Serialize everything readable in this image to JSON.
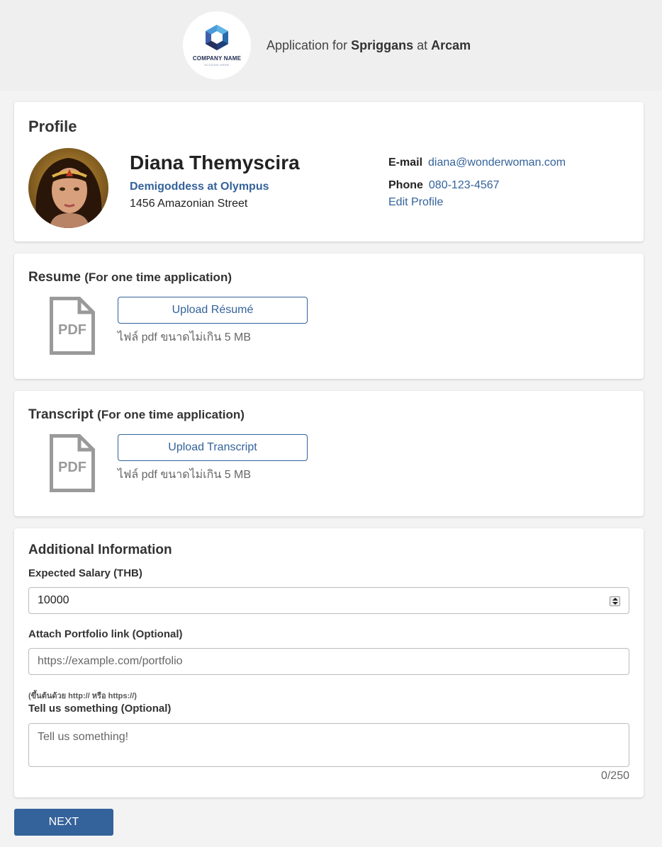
{
  "header": {
    "logo_name": "COMPANY NAME",
    "logo_slogan": "SLOGAN HERE",
    "title_prefix": "Application for",
    "position": "Spriggans",
    "title_middle": "at",
    "company": "Arcam"
  },
  "profile": {
    "section_title": "Profile",
    "name": "Diana Themyscira",
    "role": "Demigoddess at Olympus",
    "address": "1456 Amazonian Street",
    "email_label": "E-mail",
    "email": "diana@wonderwoman.com",
    "phone_label": "Phone",
    "phone": "080-123-4567",
    "edit_label": "Edit Profile"
  },
  "resume": {
    "title": "Resume",
    "title_sub": "(For one time application)",
    "icon_label": "PDF",
    "button_label": "Upload Résumé",
    "note": "ไฟล์ pdf ขนาดไม่เกิน 5 MB"
  },
  "transcript": {
    "title": "Transcript",
    "title_sub": "(For one time application)",
    "icon_label": "PDF",
    "button_label": "Upload Transcript",
    "note": "ไฟล์ pdf ขนาดไม่เกิน 5 MB"
  },
  "additional": {
    "title": "Additional Information",
    "salary_label": "Expected Salary (THB)",
    "salary_value": "10000",
    "portfolio_label": "Attach Portfolio link (Optional)",
    "portfolio_placeholder": "https://example.com/portfolio",
    "portfolio_hint": "(ขึ้นต้นด้วย http:// หรือ https://)",
    "tell_label": "Tell us something (Optional)",
    "tell_placeholder": "Tell us something!",
    "counter": "0/250"
  },
  "actions": {
    "next_label": "NEXT"
  },
  "colors": {
    "accent": "#34629a",
    "background": "#f3f3f3",
    "header_bg": "#efefef"
  }
}
